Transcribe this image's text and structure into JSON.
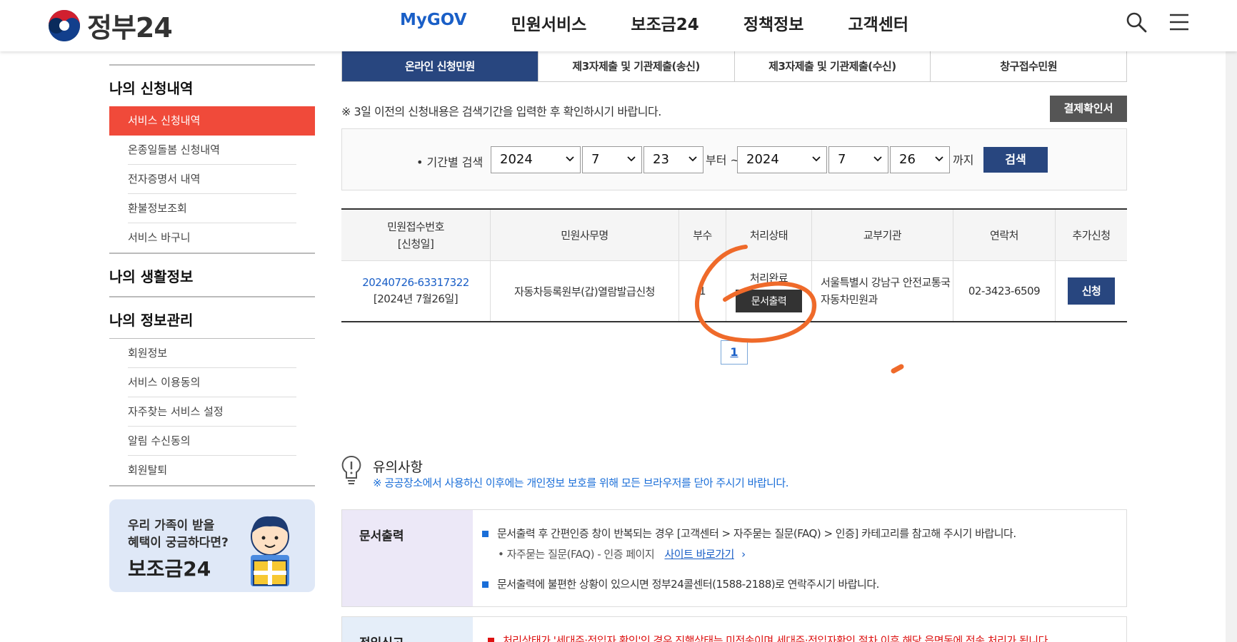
{
  "header": {
    "logo_text": "정부24",
    "nav": [
      "MyGOV",
      "민원서비스",
      "보조금24",
      "정책정보",
      "고객센터"
    ],
    "search_icon": "search-icon",
    "menu_icon": "hamburger-menu-icon"
  },
  "sidebar": {
    "section1": "나의 신청내역",
    "section1_items": [
      "서비스 신청내역",
      "온종일돌봄 신청내역",
      "전자증명서 내역",
      "환불정보조회",
      "서비스 바구니"
    ],
    "section2": "나의 생활정보",
    "section3": "나의 정보관리",
    "section3_items": [
      "회원정보",
      "서비스 이용동의",
      "자주찾는 서비스 설정",
      "알림 수신동의",
      "회원탈퇴"
    ],
    "banner": {
      "line1": "우리 가족이 받을",
      "line2": "혜택이 궁금하다면?",
      "title": "보조금24"
    }
  },
  "tabs": [
    "온라인 신청민원",
    "제3자제출 및 기관제출(송신)",
    "제3자제출 및 기관제출(수신)",
    "창구접수민원"
  ],
  "notice": "※ 3일 이전의 신청내용은 검색기간을 입력한 후 확인하시기 바랍니다.",
  "receipt_button": "결제확인서",
  "search": {
    "label": "• 기간별 검색",
    "from_year": "2024",
    "from_month": "7",
    "from_day": "23",
    "from_text": "부터 ~",
    "to_year": "2024",
    "to_month": "7",
    "to_day": "26",
    "to_text": "까지",
    "button": "검색"
  },
  "table": {
    "headers": [
      "민원접수번호\n[신청일]",
      "민원사무명",
      "부수",
      "처리상태",
      "교부기관",
      "연락처",
      "추가신청"
    ],
    "row": {
      "receipt_no": "20240726-63317322",
      "date": "[2024년 7월26일]",
      "service": "자동차등록원부(갑)열람발급신청",
      "copies": "1",
      "status": "처리완료",
      "print_button": "문서출력",
      "org_line1": "서울특별시 강남구 안전교통국",
      "org_line2": "자동차민원과",
      "contact": "02-3423-6509",
      "apply_button": "신청"
    }
  },
  "pagination": {
    "current": "1"
  },
  "caution": {
    "title": "유의사항",
    "sub": "※ 공공장소에서 사용하신 이후에는 개인정보 보호를 위해 모든 브라우저를 닫아 주시기 바랍니다."
  },
  "info": {
    "label": "문서출력",
    "b1": "문서출력 후 간편인증 창이 반복되는 경우 [고객센터 > 자주묻는 질문(FAQ) > 인증] 카테고리를 참고해 주시기 바랍니다.",
    "b1_sub": "• 자주묻는 질문(FAQ) - 인증 페이지",
    "b1_link": "사이트 바로가기",
    "b2": "문서출력에 불편한 상황이 있으시면 정부24콜센터(1588-2188)로 연락주시기 바랍니다.",
    "label2": "전입신고",
    "red": "처리상태가 '세대주·전입자 확인'인 경우 진행상태는 미전송이며 세대주·전입자확인 절차 이후 해당 읍면동에 전송 처리가 됩니다."
  },
  "colors": {
    "accent_blue": "#1a5fc7",
    "navy": "#28467f",
    "red": "#f04a3a",
    "annotation": "#ef6a2a"
  }
}
